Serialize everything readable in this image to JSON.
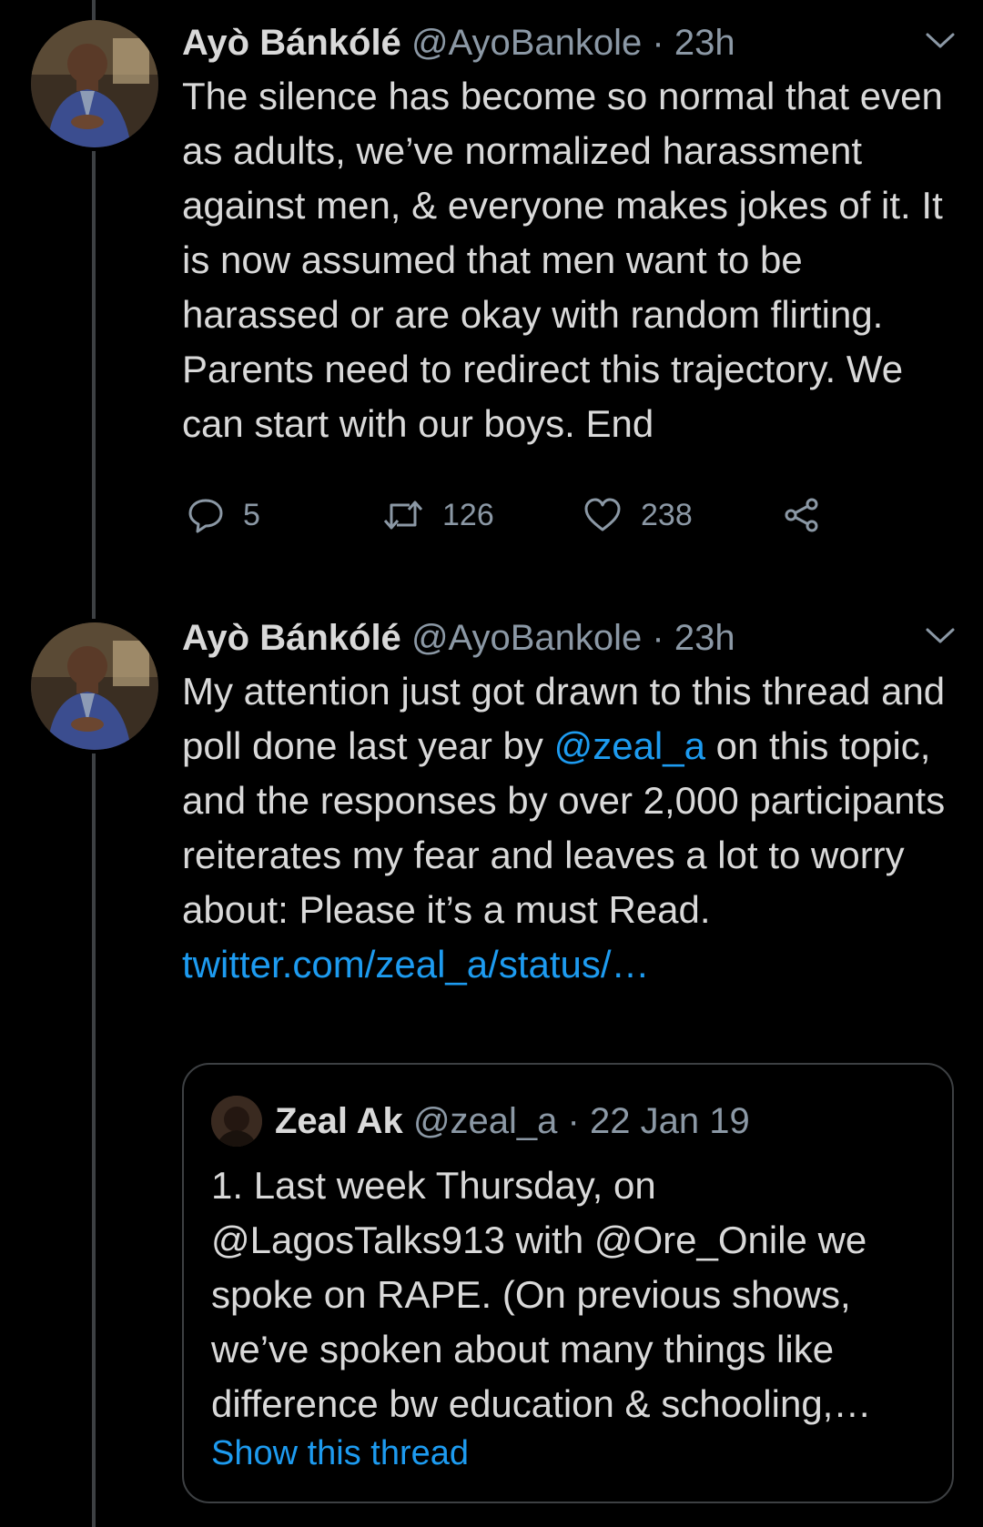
{
  "tweets": [
    {
      "display_name": "Ayò Bánkólé",
      "handle": "@AyoBankole",
      "separator": "·",
      "time": "23h",
      "avatar_icon": "profile-photo",
      "text": "The silence has become so normal that even as adults, we’ve normalized harassment against men, & everyone makes jokes of it. It is now assumed that men want to be harassed or are okay with random flirting. Parents need to redirect this trajectory. We can start with our boys. End",
      "actions": {
        "reply_count": "5",
        "retweet_count": "126",
        "like_count": "238"
      }
    },
    {
      "display_name": "Ayò Bánkólé",
      "handle": "@AyoBankole",
      "separator": "·",
      "time": "23h",
      "avatar_icon": "profile-photo",
      "text_before_mention": "My attention just got drawn to this thread and poll done last year by ",
      "mention": "@zeal_a",
      "text_after_mention": " on this topic, and the responses by over 2,000 participants reiterates my fear and leaves a lot to worry about: Please it’s a must Read.",
      "link": "twitter.com/zeal_a/status/…",
      "quoted": {
        "display_name": "Zeal Ak",
        "handle": "@zeal_a",
        "separator": "·",
        "date": "22 Jan 19",
        "text": "1. Last week Thursday, on @LagosTalks913 with @Ore_Onile we spoke on RAPE. (On previous shows, we’ve spoken about many things like difference bw education & schooling,…",
        "show_thread": "Show this thread"
      }
    }
  ],
  "colors": {
    "background": "#000000",
    "text": "#d9d9d9",
    "secondary": "#8b98a5",
    "link": "#1d9bf0",
    "border": "#3d4043"
  }
}
